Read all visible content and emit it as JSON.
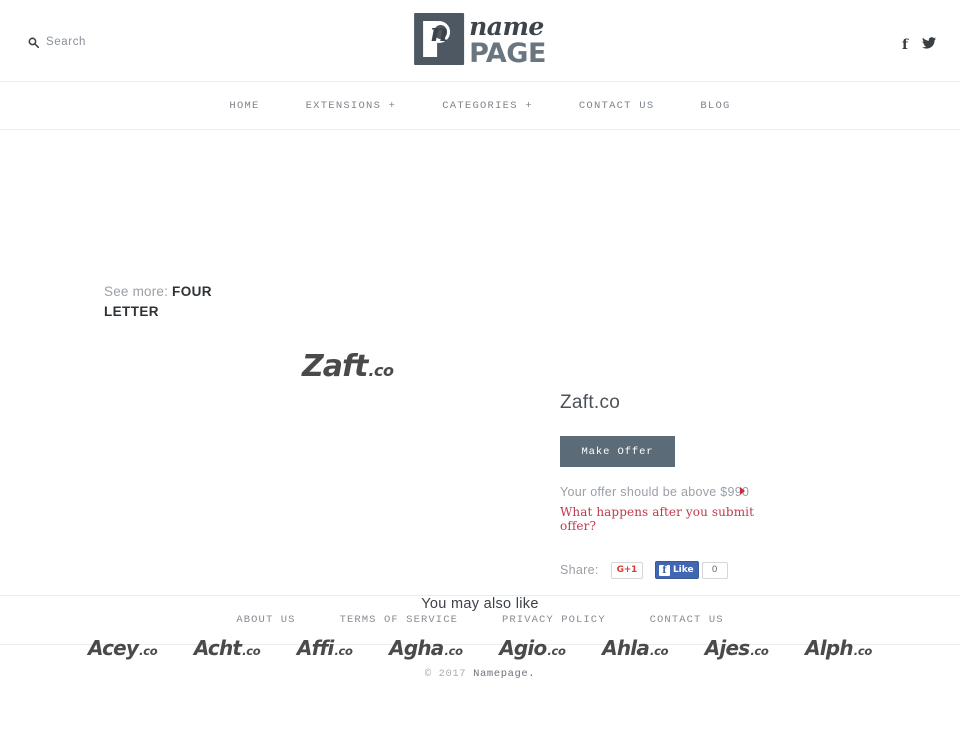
{
  "header": {
    "search": {
      "label": "Search",
      "icon": "search-icon"
    },
    "logo": {
      "mark_letter": "n",
      "name": "name",
      "page": "PAGE"
    },
    "social": [
      {
        "name": "facebook-icon",
        "glyph": "f"
      },
      {
        "name": "twitter-icon",
        "glyph": "bird"
      }
    ]
  },
  "nav": {
    "items": [
      {
        "label": "HOME"
      },
      {
        "label": "EXTENSIONS +"
      },
      {
        "label": "CATEGORIES +"
      },
      {
        "label": "CONTACT US"
      },
      {
        "label": "BLOG"
      }
    ]
  },
  "main": {
    "see_more": {
      "prefix": "See more:",
      "category": "FOUR LETTER"
    },
    "domain_art": {
      "sld": "Zaft",
      "tld": ".co"
    },
    "detail": {
      "title": "Zaft.co",
      "make_offer_label": "Make Offer",
      "offer_note": "Your offer should be above $990",
      "minimum_price": "$990",
      "help_link": "What happens after you submit offer?",
      "share_label": "Share:",
      "gplus_label": "G+1",
      "fb_like_label": "Like",
      "fb_like_count": "0"
    }
  },
  "also_like": {
    "title": "You may also like",
    "items": [
      {
        "sld": "Acey",
        "tld": ".co"
      },
      {
        "sld": "Acht",
        "tld": ".co"
      },
      {
        "sld": "Affi",
        "tld": ".co"
      },
      {
        "sld": "Agha",
        "tld": ".co"
      },
      {
        "sld": "Agio",
        "tld": ".co"
      },
      {
        "sld": "Ahla",
        "tld": ".co"
      },
      {
        "sld": "Ajes",
        "tld": ".co"
      },
      {
        "sld": "Alph",
        "tld": ".co"
      }
    ]
  },
  "footer": {
    "links": [
      {
        "label": "ABOUT US"
      },
      {
        "label": "TERMS OF SERVICE"
      },
      {
        "label": "PRIVACY POLICY"
      },
      {
        "label": "CONTACT US"
      }
    ],
    "copyright_prefix": "© 2017",
    "brand": "Namepage."
  },
  "colors": {
    "button": "#5c6b78",
    "accent_red": "#c0394b",
    "text_muted": "#9aa0a6",
    "logo_dark": "#4e5862"
  }
}
